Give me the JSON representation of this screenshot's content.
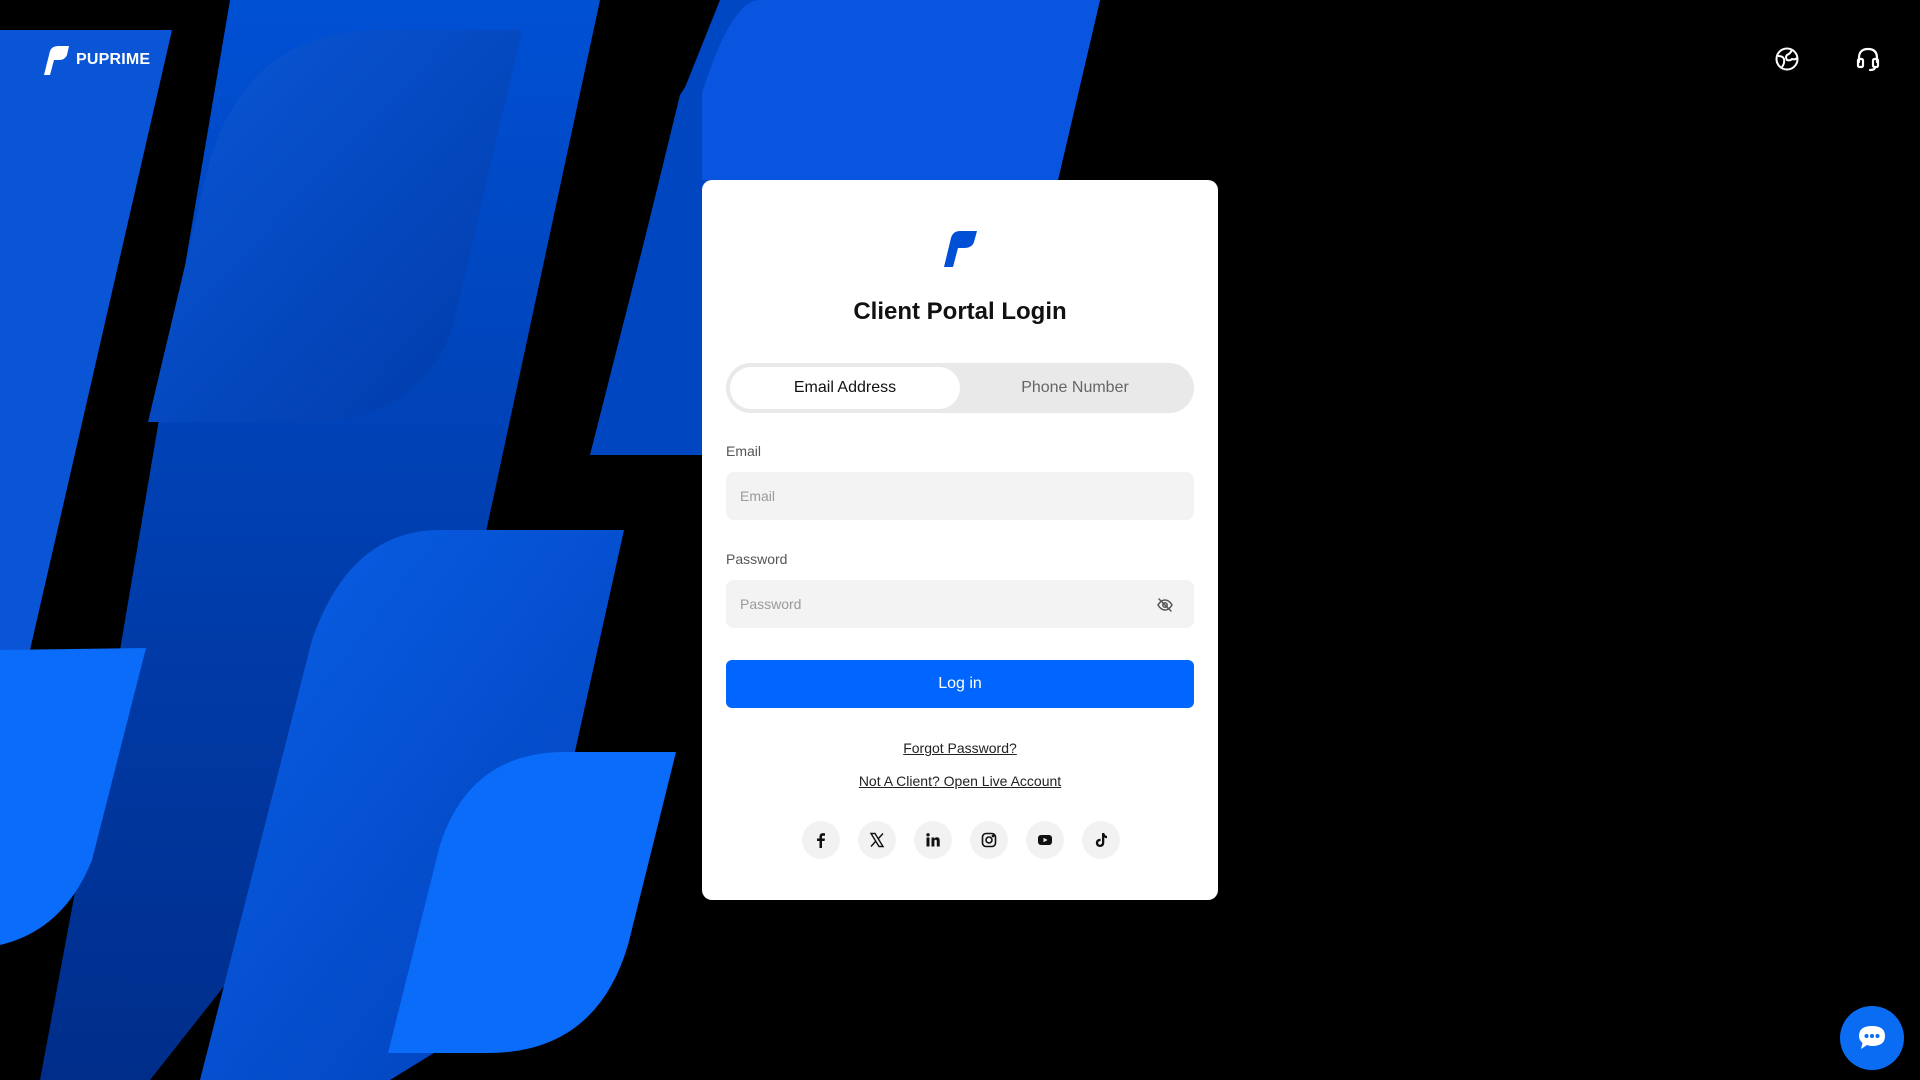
{
  "brand": {
    "name": "PUPRIME",
    "logo_icon": "puprime-logo-icon"
  },
  "header": {
    "language_icon": "globe-icon",
    "support_icon": "headset-icon"
  },
  "card": {
    "logo_icon": "puprime-logo-icon",
    "title": "Client Portal Login",
    "tabs": [
      {
        "label": "Email Address",
        "active": true
      },
      {
        "label": "Phone Number",
        "active": false
      }
    ],
    "email": {
      "label": "Email",
      "placeholder": "Email",
      "value": ""
    },
    "password": {
      "label": "Password",
      "placeholder": "Password",
      "value": "",
      "toggle_icon": "eye-off-icon"
    },
    "login_button": "Log in",
    "forgot_password": "Forgot Password?",
    "open_account": "Not A Client? Open Live Account",
    "socials": [
      "facebook-icon",
      "x-icon",
      "linkedin-icon",
      "instagram-icon",
      "youtube-icon",
      "tiktok-icon"
    ]
  },
  "chat": {
    "icon": "chat-bubble-icon"
  },
  "colors": {
    "accent": "#0066ff",
    "brand_blue": "#0050d6",
    "background": "#000000",
    "card": "#ffffff"
  }
}
